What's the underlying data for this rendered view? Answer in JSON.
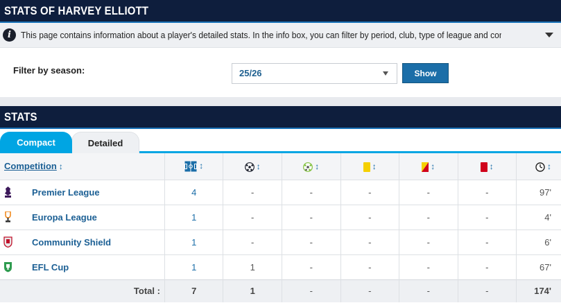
{
  "header": {
    "title": "STATS OF HARVEY ELLIOTT"
  },
  "info": {
    "icon": "info-icon",
    "text": "This page contains information about a player's detailed stats. In the info box, you can filter by period, club, type of league and competition. T..."
  },
  "filter": {
    "label": "Filter by season:",
    "selected_season": "25/26",
    "show_label": "Show"
  },
  "stats": {
    "title": "STATS",
    "tabs": [
      {
        "label": "Compact",
        "active": true
      },
      {
        "label": "Detailed",
        "active": false
      }
    ],
    "columns": {
      "competition": "Competition",
      "sort_glyph": "↕",
      "icons": [
        "appearances-icon",
        "goals-icon",
        "assists-icon",
        "yellow-card-icon",
        "second-yellow-icon",
        "red-card-icon",
        "minutes-clock-icon"
      ]
    },
    "rows": [
      {
        "competition": "Premier League",
        "logo": "premier-league-logo",
        "appearances": "4",
        "goals": "-",
        "assists": "-",
        "yellow": "-",
        "second_yellow": "-",
        "red": "-",
        "minutes": "97'"
      },
      {
        "competition": "Europa League",
        "logo": "europa-league-logo",
        "appearances": "1",
        "goals": "-",
        "assists": "-",
        "yellow": "-",
        "second_yellow": "-",
        "red": "-",
        "minutes": "4'"
      },
      {
        "competition": "Community Shield",
        "logo": "community-shield-logo",
        "appearances": "1",
        "goals": "-",
        "assists": "-",
        "yellow": "-",
        "second_yellow": "-",
        "red": "-",
        "minutes": "6'"
      },
      {
        "competition": "EFL Cup",
        "logo": "efl-cup-logo",
        "appearances": "1",
        "goals": "1",
        "assists": "-",
        "yellow": "-",
        "second_yellow": "-",
        "red": "-",
        "minutes": "67'"
      }
    ],
    "total": {
      "label": "Total :",
      "appearances": "7",
      "goals": "1",
      "assists": "-",
      "yellow": "-",
      "second_yellow": "-",
      "red": "-",
      "minutes": "174'"
    }
  },
  "colors": {
    "header_bg": "#0e1e3d",
    "accent_tab": "#00a5e3",
    "link": "#1b5f94",
    "button": "#1b6ea8",
    "yellow_card": "#f5d000",
    "red_card": "#d0021b"
  }
}
